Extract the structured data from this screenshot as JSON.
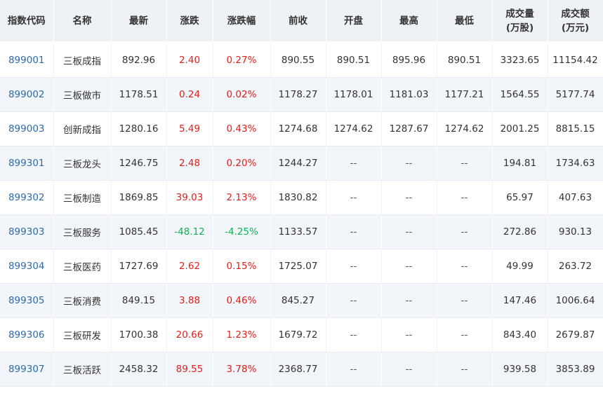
{
  "table": {
    "headers": [
      {
        "line1": "指数代码",
        "line2": ""
      },
      {
        "line1": "名称",
        "line2": ""
      },
      {
        "line1": "最新",
        "line2": ""
      },
      {
        "line1": "涨跌",
        "line2": ""
      },
      {
        "line1": "涨跌幅",
        "line2": ""
      },
      {
        "line1": "前收",
        "line2": ""
      },
      {
        "line1": "开盘",
        "line2": ""
      },
      {
        "line1": "最高",
        "line2": ""
      },
      {
        "line1": "最低",
        "line2": ""
      },
      {
        "line1": "成交量",
        "line2": "(万股)"
      },
      {
        "line1": "成交额",
        "line2": "(万元)"
      }
    ],
    "rows": [
      {
        "code": "899001",
        "name": "三板成指",
        "latest": "892.96",
        "change": "2.40",
        "change_pct": "0.27%",
        "prev_close": "890.55",
        "open": "890.51",
        "high": "895.96",
        "low": "890.51",
        "volume": "3323.65",
        "amount": "11154.42",
        "direction": "up"
      },
      {
        "code": "899002",
        "name": "三板做市",
        "latest": "1178.51",
        "change": "0.24",
        "change_pct": "0.02%",
        "prev_close": "1178.27",
        "open": "1178.01",
        "high": "1181.03",
        "low": "1177.21",
        "volume": "1564.55",
        "amount": "5177.74",
        "direction": "up"
      },
      {
        "code": "899003",
        "name": "创新成指",
        "latest": "1280.16",
        "change": "5.49",
        "change_pct": "0.43%",
        "prev_close": "1274.68",
        "open": "1274.62",
        "high": "1287.67",
        "low": "1274.62",
        "volume": "2001.25",
        "amount": "8815.15",
        "direction": "up"
      },
      {
        "code": "899301",
        "name": "三板龙头",
        "latest": "1246.75",
        "change": "2.48",
        "change_pct": "0.20%",
        "prev_close": "1244.27",
        "open": "--",
        "high": "--",
        "low": "--",
        "volume": "194.81",
        "amount": "1734.63",
        "direction": "up"
      },
      {
        "code": "899302",
        "name": "三板制造",
        "latest": "1869.85",
        "change": "39.03",
        "change_pct": "2.13%",
        "prev_close": "1830.82",
        "open": "--",
        "high": "--",
        "low": "--",
        "volume": "65.97",
        "amount": "407.63",
        "direction": "up"
      },
      {
        "code": "899303",
        "name": "三板服务",
        "latest": "1085.45",
        "change": "-48.12",
        "change_pct": "-4.25%",
        "prev_close": "1133.57",
        "open": "--",
        "high": "--",
        "low": "--",
        "volume": "272.86",
        "amount": "930.13",
        "direction": "down"
      },
      {
        "code": "899304",
        "name": "三板医药",
        "latest": "1727.69",
        "change": "2.62",
        "change_pct": "0.15%",
        "prev_close": "1725.07",
        "open": "--",
        "high": "--",
        "low": "--",
        "volume": "49.99",
        "amount": "263.72",
        "direction": "up"
      },
      {
        "code": "899305",
        "name": "三板消费",
        "latest": "849.15",
        "change": "3.88",
        "change_pct": "0.46%",
        "prev_close": "845.27",
        "open": "--",
        "high": "--",
        "low": "--",
        "volume": "147.46",
        "amount": "1006.64",
        "direction": "up"
      },
      {
        "code": "899306",
        "name": "三板研发",
        "latest": "1700.38",
        "change": "20.66",
        "change_pct": "1.23%",
        "prev_close": "1679.72",
        "open": "--",
        "high": "--",
        "low": "--",
        "volume": "843.40",
        "amount": "2679.87",
        "direction": "up"
      },
      {
        "code": "899307",
        "name": "三板活跃",
        "latest": "2458.32",
        "change": "89.55",
        "change_pct": "3.78%",
        "prev_close": "2368.77",
        "open": "--",
        "high": "--",
        "low": "--",
        "volume": "939.58",
        "amount": "3853.89",
        "direction": "up"
      }
    ]
  },
  "colors": {
    "up": "#e0201c",
    "down": "#13b256",
    "code_link": "#2e6ba8",
    "header_bg": "#eef2f7",
    "stripe_bg": "#f2f5f9"
  }
}
